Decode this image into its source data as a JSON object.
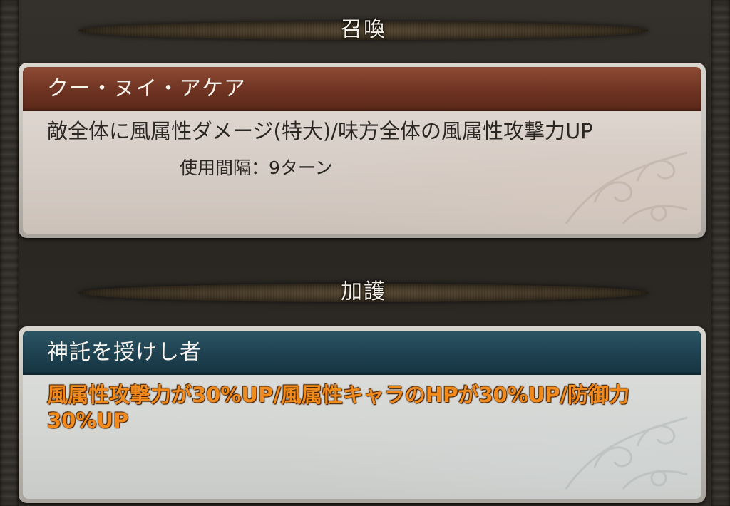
{
  "summon_section": {
    "header": "召喚",
    "name": "クー・ヌイ・アケア",
    "description": "敵全体に風属性ダメージ(特大)/味方全体の風属性攻撃力UP",
    "interval": "使用間隔：9ターン"
  },
  "aura_section": {
    "header": "加護",
    "name": "神託を授けし者",
    "description": "風属性攻撃力が30%UP/風属性キャラのHPが30%UP/防御力30%UP"
  },
  "colors": {
    "summon_title_bar": "#6e3322",
    "aura_title_bar": "#1e4150",
    "aura_text": "#f08a1c"
  }
}
